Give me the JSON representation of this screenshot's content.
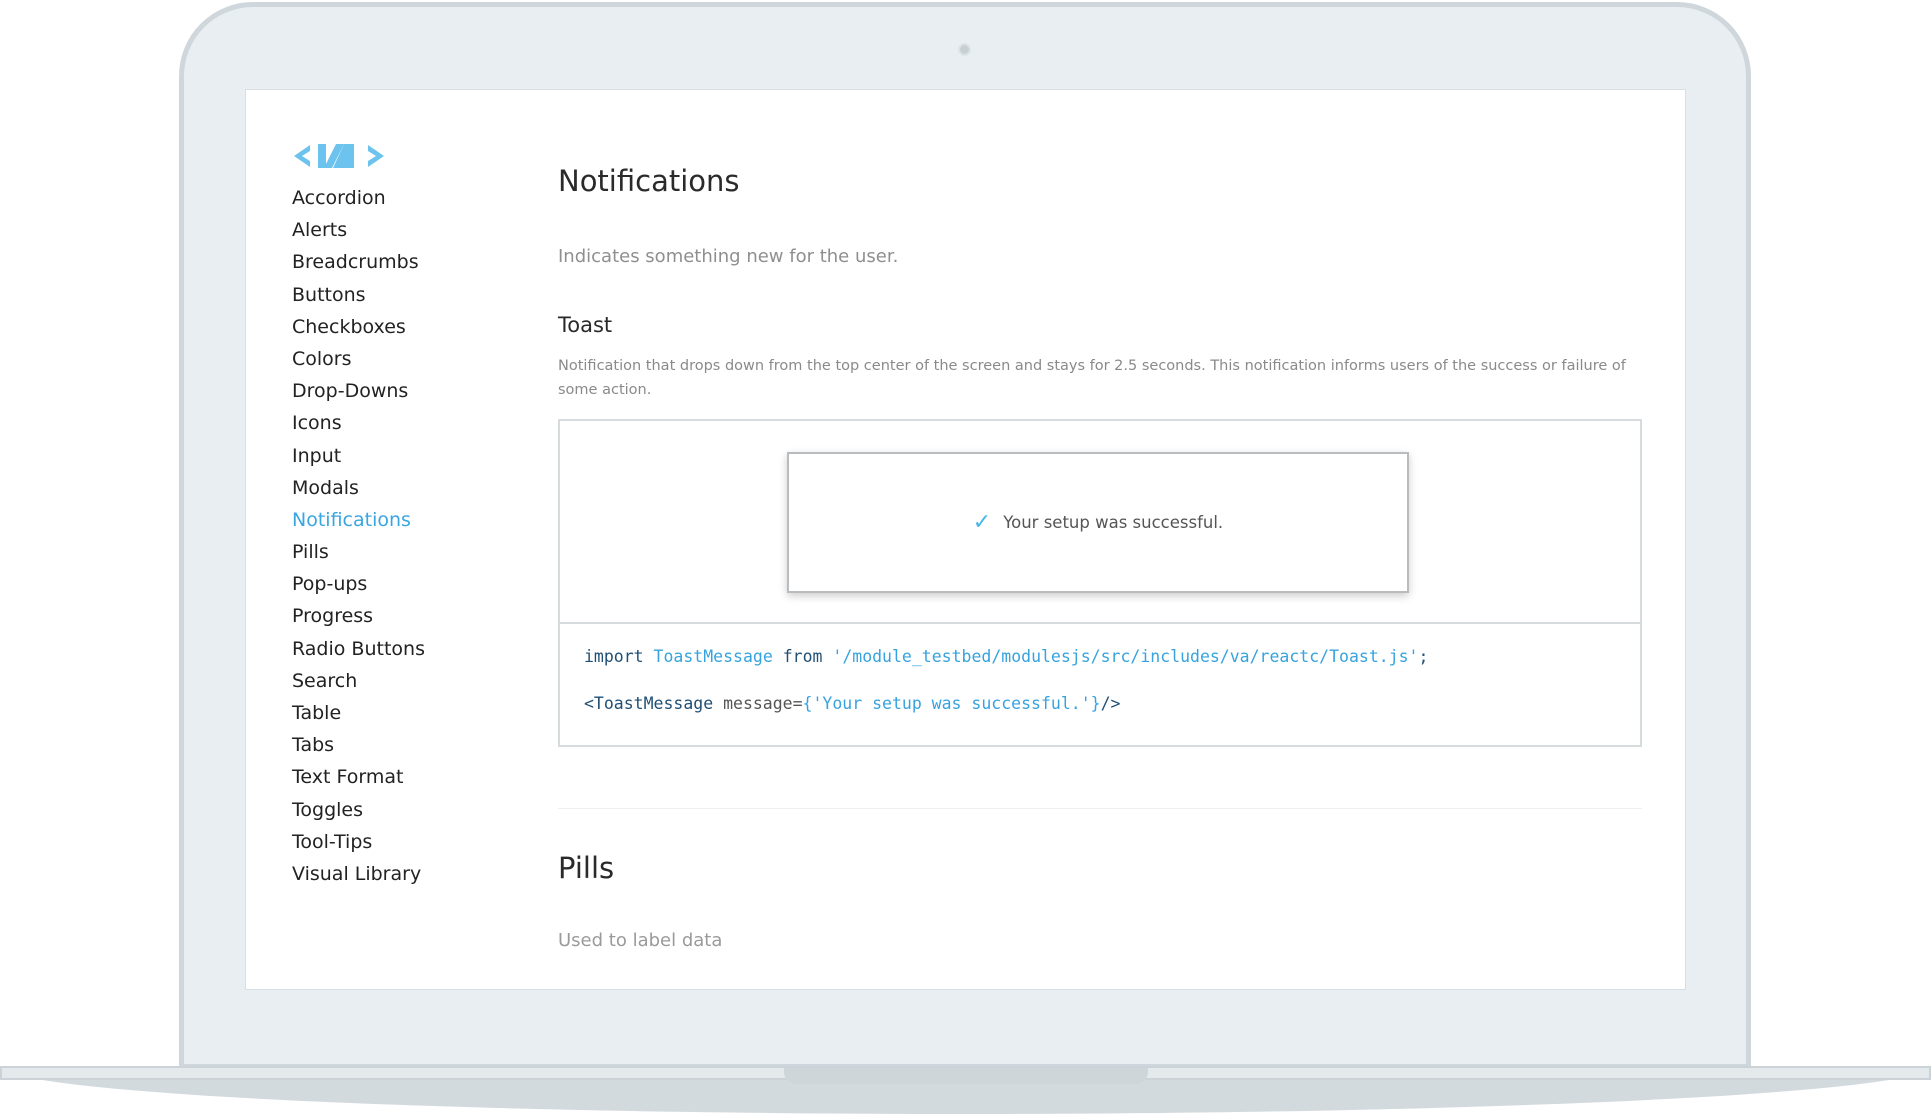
{
  "logo": "<VA>",
  "sidebar": {
    "active": "Notifications",
    "items": [
      "Accordion",
      "Alerts",
      "Breadcrumbs",
      "Buttons",
      "Checkboxes",
      "Colors",
      "Drop-Downs",
      "Icons",
      "Input",
      "Modals",
      "Notifications",
      "Pills",
      "Pop-ups",
      "Progress",
      "Radio Buttons",
      "Search",
      "Table",
      "Tabs",
      "Text Format",
      "Toggles",
      "Tool-Tips",
      "Visual Library"
    ]
  },
  "main": {
    "title": "Notifications",
    "subtitle": "Indicates something new for the user.",
    "toast": {
      "heading": "Toast",
      "description": "Notification that drops down from the top center of the screen and stays for 2.5 seconds. This notification informs users of the success or failure of some action.",
      "message": "Your setup was successful.",
      "icon": "check-icon"
    },
    "code": {
      "l1_import": "import",
      "l1_name": "ToastMessage",
      "l1_from": "from",
      "l1_path": "'/module_testbed/modulesjs/src/includes/va/reactc/Toast.js'",
      "l1_end": ";",
      "l2_tag": "<ToastMessage",
      "l2_attr": " message=",
      "l2_value": "{'Your setup was successful.'}",
      "l2_end": "/>"
    },
    "pills": {
      "title": "Pills",
      "subtitle": "Used to label data"
    }
  },
  "colors": {
    "accent": "#3aa6e0",
    "code_keyword": "#1f4f75"
  }
}
